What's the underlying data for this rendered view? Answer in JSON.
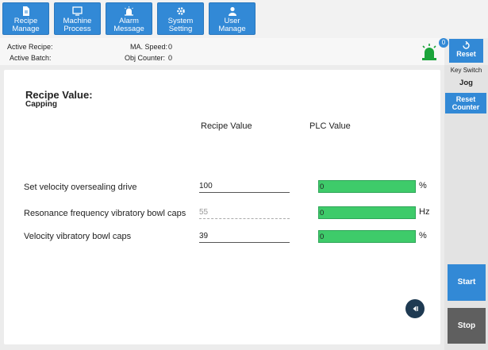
{
  "nav": [
    {
      "line1": "Recipe",
      "line2": "Manage",
      "icon": "document-icon"
    },
    {
      "line1": "Machine",
      "line2": "Process",
      "icon": "monitor-icon"
    },
    {
      "line1": "Alarm",
      "line2": "Message",
      "icon": "alarm-icon"
    },
    {
      "line1": "System",
      "line2": "Setting",
      "icon": "gear-icon"
    },
    {
      "line1": "User",
      "line2": "Manage",
      "icon": "user-icon"
    }
  ],
  "info": {
    "active_recipe_label": "Active Recipe:",
    "active_batch_label": "Active Batch:",
    "ma_speed_label": "MA. Speed:",
    "ma_speed_value": "0",
    "obj_counter_label": "Obj Counter:",
    "obj_counter_value": "0",
    "alarm_count": "0"
  },
  "right": {
    "reset_label": "Reset",
    "key_switch_label": "Key Switch",
    "key_switch_value": "Jog",
    "reset_counter_line1": "Reset",
    "reset_counter_line2": "Counter",
    "start_label": "Start",
    "stop_label": "Stop"
  },
  "main": {
    "title": "Recipe Value:",
    "subtitle": "Capping",
    "col_recipe": "Recipe Value",
    "col_plc": "PLC Value",
    "rows": [
      {
        "label": "Set velocity oversealing drive",
        "recipe_value": "100",
        "plc_value": "0",
        "unit": "%"
      },
      {
        "label": "Resonance frequency vibratory bowl caps",
        "recipe_value": "55",
        "plc_value": "0",
        "unit": "Hz"
      },
      {
        "label": "Velocity vibratory bowl caps",
        "recipe_value": "39",
        "plc_value": "0",
        "unit": "%"
      }
    ]
  },
  "colors": {
    "accent": "#3289d6",
    "plc_bar": "#3ecb6a",
    "alarm_green": "#1aa33a",
    "stop": "#5f5f5f"
  }
}
